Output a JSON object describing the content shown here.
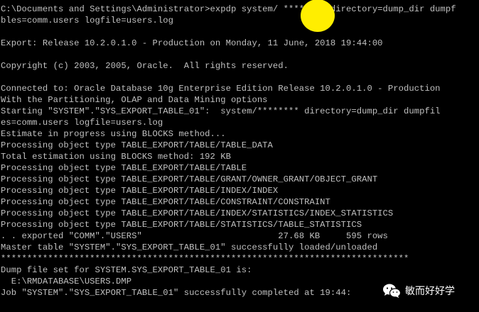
{
  "console": {
    "foreground": "#c0c0c0",
    "background": "#000000",
    "lines": [
      "C:\\Documents and Settings\\Administrator>expdp system/ ******** directory=dump_dir dumpf",
      "bles=comm.users logfile=users.log",
      "",
      "Export: Release 10.2.0.1.0 - Production on Monday, 11 June, 2018 19:44:00",
      "",
      "Copyright (c) 2003, 2005, Oracle.  All rights reserved.",
      "",
      "Connected to: Oracle Database 10g Enterprise Edition Release 10.2.0.1.0 - Production",
      "With the Partitioning, OLAP and Data Mining options",
      "Starting \"SYSTEM\".\"SYS_EXPORT_TABLE_01\":  system/******** directory=dump_dir dumpfil",
      "es=comm.users logfile=users.log",
      "Estimate in progress using BLOCKS method...",
      "Processing object type TABLE_EXPORT/TABLE/TABLE_DATA",
      "Total estimation using BLOCKS method: 192 KB",
      "Processing object type TABLE_EXPORT/TABLE/TABLE",
      "Processing object type TABLE_EXPORT/TABLE/GRANT/OWNER_GRANT/OBJECT_GRANT",
      "Processing object type TABLE_EXPORT/TABLE/INDEX/INDEX",
      "Processing object type TABLE_EXPORT/TABLE/CONSTRAINT/CONSTRAINT",
      "Processing object type TABLE_EXPORT/TABLE/INDEX/STATISTICS/INDEX_STATISTICS",
      "Processing object type TABLE_EXPORT/TABLE/STATISTICS/TABLE_STATISTICS",
      ". . exported \"COMM\".\"USERS\"                          27.68 KB     595 rows",
      "Master table \"SYSTEM\".\"SYS_EXPORT_TABLE_01\" successfully loaded/unloaded",
      "******************************************************************************",
      "Dump file set for SYSTEM.SYS_EXPORT_TABLE_01 is:",
      "  E:\\RMDATABASE\\USERS.DMP",
      "Job \"SYSTEM\".\"SYS_EXPORT_TABLE_01\" successfully completed at 19:44:"
    ]
  },
  "overlay": {
    "cursor_color": "#ffee00"
  },
  "watermark": {
    "icon": "wechat-icon",
    "text": "敏而好好学"
  }
}
